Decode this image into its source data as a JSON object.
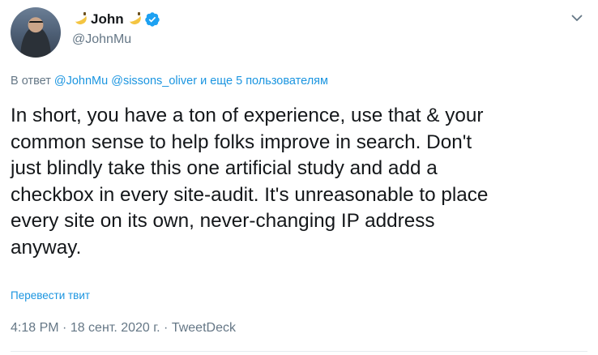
{
  "author": {
    "display_name": "John",
    "handle": "@JohnMu",
    "emoji_name": "banana-emoji",
    "verified": true,
    "verified_color": "#1da1f2"
  },
  "reply": {
    "prefix": "В ответ",
    "mentions": [
      "@JohnMu",
      "@sissons_oliver"
    ],
    "others": "и еще 5 пользователям"
  },
  "tweet": {
    "lines": [
      "In short, you have a ton of experience, use that & your",
      "common sense to help folks improve in search. Don't",
      "just blindly take this one artificial study and add a",
      "checkbox in every site-audit. It's unreasonable to place",
      "every site on its own, never-changing IP address",
      "anyway."
    ]
  },
  "translate_label": "Перевести твит",
  "meta": {
    "time": "4:18 PM",
    "separator": " · ",
    "date": "18 сент. 2020 г.",
    "source": "TweetDeck"
  },
  "colors": {
    "link": "#1b95e0",
    "muted": "#657786",
    "text": "#14171a"
  }
}
